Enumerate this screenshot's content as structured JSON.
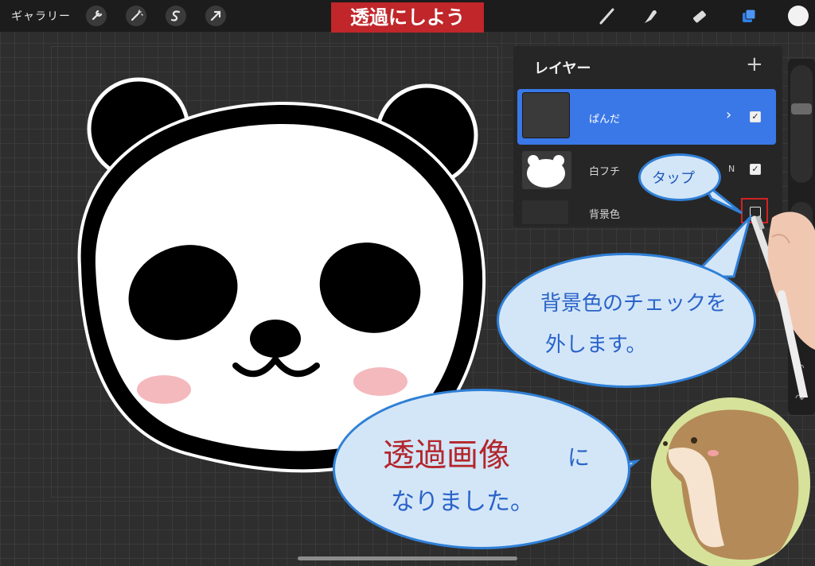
{
  "topbar": {
    "gallery_label": "ギャラリー",
    "title": "透過にしよう"
  },
  "layers_panel": {
    "title": "レイヤー",
    "add_symbol": "+",
    "layers": [
      {
        "name": "ぱんだ",
        "blend": "",
        "visible": true,
        "selected": true
      },
      {
        "name": "白フチ",
        "blend": "N",
        "visible": true,
        "selected": false
      },
      {
        "name": "背景色",
        "blend": "",
        "visible": false,
        "selected": false
      }
    ]
  },
  "annotations": {
    "tap": "タップ",
    "uncheck_line1": "背景色のチェックを",
    "uncheck_line2": "外します。",
    "transparent_word": "透過画像",
    "transparent_particle": "に",
    "transparent_line2": "なりました。"
  },
  "colors": {
    "accent": "#3a78e8",
    "title_badge": "#c0262a",
    "highlight_box": "#d22222"
  },
  "icons": [
    "wrench-icon",
    "magic-wand-icon",
    "selection-s-icon",
    "transform-arrow-icon",
    "brush-icon",
    "smudge-icon",
    "eraser-icon",
    "layers-icon",
    "color-dot"
  ]
}
